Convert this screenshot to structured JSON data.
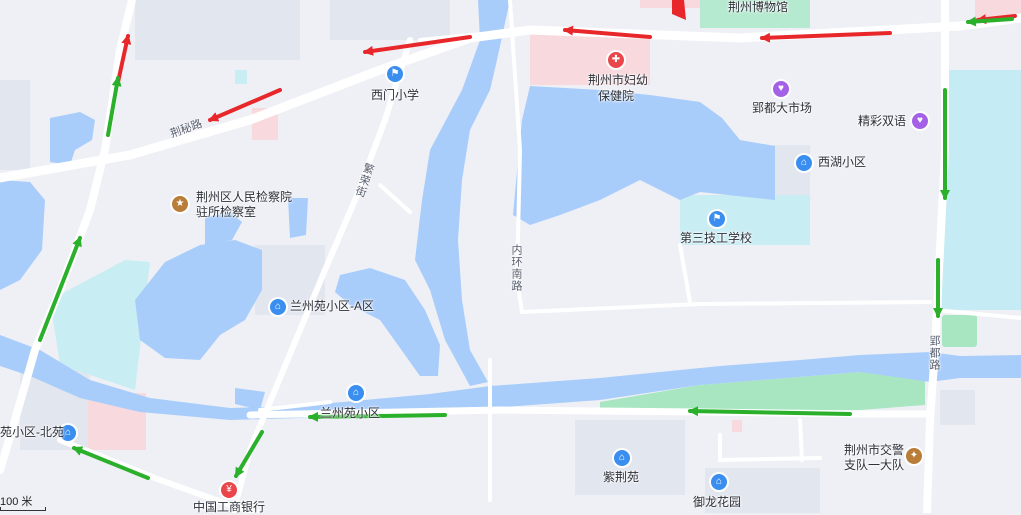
{
  "colors": {
    "water": "#a9cdfb",
    "green": "#a8e6c2",
    "block": "#e1e5ee",
    "pink": "#f8d9dd",
    "road": "#ffffff",
    "traffic_red": "#e8272b",
    "traffic_green": "#2ab02a",
    "icon_blue": "#3a8ef0",
    "icon_purple": "#a461e8",
    "icon_red": "#e9474c",
    "icon_brown": "#b97d3a"
  },
  "pois": [
    {
      "id": "museum",
      "name": "荆州博物馆",
      "icon": "museum-icon"
    },
    {
      "id": "hospital",
      "name1": "荆州市妇幼",
      "name2": "保健院",
      "icon": "hospital-icon"
    },
    {
      "id": "school_ximen",
      "name": "西门小学",
      "icon": "school-icon"
    },
    {
      "id": "market",
      "name": "郢都大市场",
      "icon": "shopping-icon"
    },
    {
      "id": "jingcai",
      "name": "精彩双语",
      "icon": "shopping-icon"
    },
    {
      "id": "xihu",
      "name": "西湖小区",
      "icon": "residential-icon"
    },
    {
      "id": "procuratorate",
      "name1": "荆州区人民检察院",
      "name2": "驻所检察室",
      "icon": "government-icon"
    },
    {
      "id": "tech_school",
      "name": "第三技工学校",
      "icon": "school-icon"
    },
    {
      "id": "lanzhou_a",
      "name": "兰州苑小区-A区",
      "icon": "residential-icon"
    },
    {
      "id": "lanzhou",
      "name": "兰州苑小区",
      "icon": "residential-icon"
    },
    {
      "id": "north",
      "name": "苑小区-北苑",
      "icon": "residential-icon"
    },
    {
      "id": "zijing",
      "name": "紫荆苑",
      "icon": "residential-icon"
    },
    {
      "id": "yulong",
      "name": "御龙花园",
      "icon": "residential-icon"
    },
    {
      "id": "traffic_police",
      "name1": "荆州市交警",
      "name2": "支队一大队",
      "icon": "police-icon"
    },
    {
      "id": "icbc",
      "name": "中国工商银行",
      "icon": "bank-icon"
    }
  ],
  "roads": {
    "jingmi": "荆秘路",
    "fanrong": "繁荣街",
    "neihuan": "内环南路",
    "yingdu": "郢都路"
  },
  "scale_label": "100 米"
}
